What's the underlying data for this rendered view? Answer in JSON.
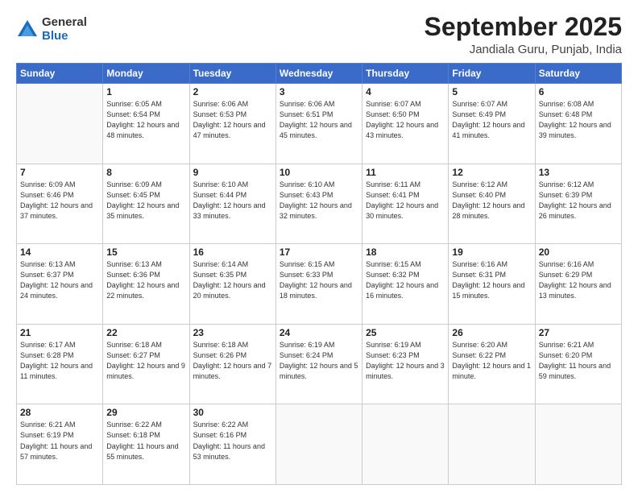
{
  "logo": {
    "general": "General",
    "blue": "Blue"
  },
  "header": {
    "month": "September 2025",
    "location": "Jandiala Guru, Punjab, India"
  },
  "weekdays": [
    "Sunday",
    "Monday",
    "Tuesday",
    "Wednesday",
    "Thursday",
    "Friday",
    "Saturday"
  ],
  "weeks": [
    [
      {
        "day": "",
        "sunrise": "",
        "sunset": "",
        "daylight": ""
      },
      {
        "day": "1",
        "sunrise": "Sunrise: 6:05 AM",
        "sunset": "Sunset: 6:54 PM",
        "daylight": "Daylight: 12 hours and 48 minutes."
      },
      {
        "day": "2",
        "sunrise": "Sunrise: 6:06 AM",
        "sunset": "Sunset: 6:53 PM",
        "daylight": "Daylight: 12 hours and 47 minutes."
      },
      {
        "day": "3",
        "sunrise": "Sunrise: 6:06 AM",
        "sunset": "Sunset: 6:51 PM",
        "daylight": "Daylight: 12 hours and 45 minutes."
      },
      {
        "day": "4",
        "sunrise": "Sunrise: 6:07 AM",
        "sunset": "Sunset: 6:50 PM",
        "daylight": "Daylight: 12 hours and 43 minutes."
      },
      {
        "day": "5",
        "sunrise": "Sunrise: 6:07 AM",
        "sunset": "Sunset: 6:49 PM",
        "daylight": "Daylight: 12 hours and 41 minutes."
      },
      {
        "day": "6",
        "sunrise": "Sunrise: 6:08 AM",
        "sunset": "Sunset: 6:48 PM",
        "daylight": "Daylight: 12 hours and 39 minutes."
      }
    ],
    [
      {
        "day": "7",
        "sunrise": "Sunrise: 6:09 AM",
        "sunset": "Sunset: 6:46 PM",
        "daylight": "Daylight: 12 hours and 37 minutes."
      },
      {
        "day": "8",
        "sunrise": "Sunrise: 6:09 AM",
        "sunset": "Sunset: 6:45 PM",
        "daylight": "Daylight: 12 hours and 35 minutes."
      },
      {
        "day": "9",
        "sunrise": "Sunrise: 6:10 AM",
        "sunset": "Sunset: 6:44 PM",
        "daylight": "Daylight: 12 hours and 33 minutes."
      },
      {
        "day": "10",
        "sunrise": "Sunrise: 6:10 AM",
        "sunset": "Sunset: 6:43 PM",
        "daylight": "Daylight: 12 hours and 32 minutes."
      },
      {
        "day": "11",
        "sunrise": "Sunrise: 6:11 AM",
        "sunset": "Sunset: 6:41 PM",
        "daylight": "Daylight: 12 hours and 30 minutes."
      },
      {
        "day": "12",
        "sunrise": "Sunrise: 6:12 AM",
        "sunset": "Sunset: 6:40 PM",
        "daylight": "Daylight: 12 hours and 28 minutes."
      },
      {
        "day": "13",
        "sunrise": "Sunrise: 6:12 AM",
        "sunset": "Sunset: 6:39 PM",
        "daylight": "Daylight: 12 hours and 26 minutes."
      }
    ],
    [
      {
        "day": "14",
        "sunrise": "Sunrise: 6:13 AM",
        "sunset": "Sunset: 6:37 PM",
        "daylight": "Daylight: 12 hours and 24 minutes."
      },
      {
        "day": "15",
        "sunrise": "Sunrise: 6:13 AM",
        "sunset": "Sunset: 6:36 PM",
        "daylight": "Daylight: 12 hours and 22 minutes."
      },
      {
        "day": "16",
        "sunrise": "Sunrise: 6:14 AM",
        "sunset": "Sunset: 6:35 PM",
        "daylight": "Daylight: 12 hours and 20 minutes."
      },
      {
        "day": "17",
        "sunrise": "Sunrise: 6:15 AM",
        "sunset": "Sunset: 6:33 PM",
        "daylight": "Daylight: 12 hours and 18 minutes."
      },
      {
        "day": "18",
        "sunrise": "Sunrise: 6:15 AM",
        "sunset": "Sunset: 6:32 PM",
        "daylight": "Daylight: 12 hours and 16 minutes."
      },
      {
        "day": "19",
        "sunrise": "Sunrise: 6:16 AM",
        "sunset": "Sunset: 6:31 PM",
        "daylight": "Daylight: 12 hours and 15 minutes."
      },
      {
        "day": "20",
        "sunrise": "Sunrise: 6:16 AM",
        "sunset": "Sunset: 6:29 PM",
        "daylight": "Daylight: 12 hours and 13 minutes."
      }
    ],
    [
      {
        "day": "21",
        "sunrise": "Sunrise: 6:17 AM",
        "sunset": "Sunset: 6:28 PM",
        "daylight": "Daylight: 12 hours and 11 minutes."
      },
      {
        "day": "22",
        "sunrise": "Sunrise: 6:18 AM",
        "sunset": "Sunset: 6:27 PM",
        "daylight": "Daylight: 12 hours and 9 minutes."
      },
      {
        "day": "23",
        "sunrise": "Sunrise: 6:18 AM",
        "sunset": "Sunset: 6:26 PM",
        "daylight": "Daylight: 12 hours and 7 minutes."
      },
      {
        "day": "24",
        "sunrise": "Sunrise: 6:19 AM",
        "sunset": "Sunset: 6:24 PM",
        "daylight": "Daylight: 12 hours and 5 minutes."
      },
      {
        "day": "25",
        "sunrise": "Sunrise: 6:19 AM",
        "sunset": "Sunset: 6:23 PM",
        "daylight": "Daylight: 12 hours and 3 minutes."
      },
      {
        "day": "26",
        "sunrise": "Sunrise: 6:20 AM",
        "sunset": "Sunset: 6:22 PM",
        "daylight": "Daylight: 12 hours and 1 minute."
      },
      {
        "day": "27",
        "sunrise": "Sunrise: 6:21 AM",
        "sunset": "Sunset: 6:20 PM",
        "daylight": "Daylight: 11 hours and 59 minutes."
      }
    ],
    [
      {
        "day": "28",
        "sunrise": "Sunrise: 6:21 AM",
        "sunset": "Sunset: 6:19 PM",
        "daylight": "Daylight: 11 hours and 57 minutes."
      },
      {
        "day": "29",
        "sunrise": "Sunrise: 6:22 AM",
        "sunset": "Sunset: 6:18 PM",
        "daylight": "Daylight: 11 hours and 55 minutes."
      },
      {
        "day": "30",
        "sunrise": "Sunrise: 6:22 AM",
        "sunset": "Sunset: 6:16 PM",
        "daylight": "Daylight: 11 hours and 53 minutes."
      },
      {
        "day": "",
        "sunrise": "",
        "sunset": "",
        "daylight": ""
      },
      {
        "day": "",
        "sunrise": "",
        "sunset": "",
        "daylight": ""
      },
      {
        "day": "",
        "sunrise": "",
        "sunset": "",
        "daylight": ""
      },
      {
        "day": "",
        "sunrise": "",
        "sunset": "",
        "daylight": ""
      }
    ]
  ]
}
